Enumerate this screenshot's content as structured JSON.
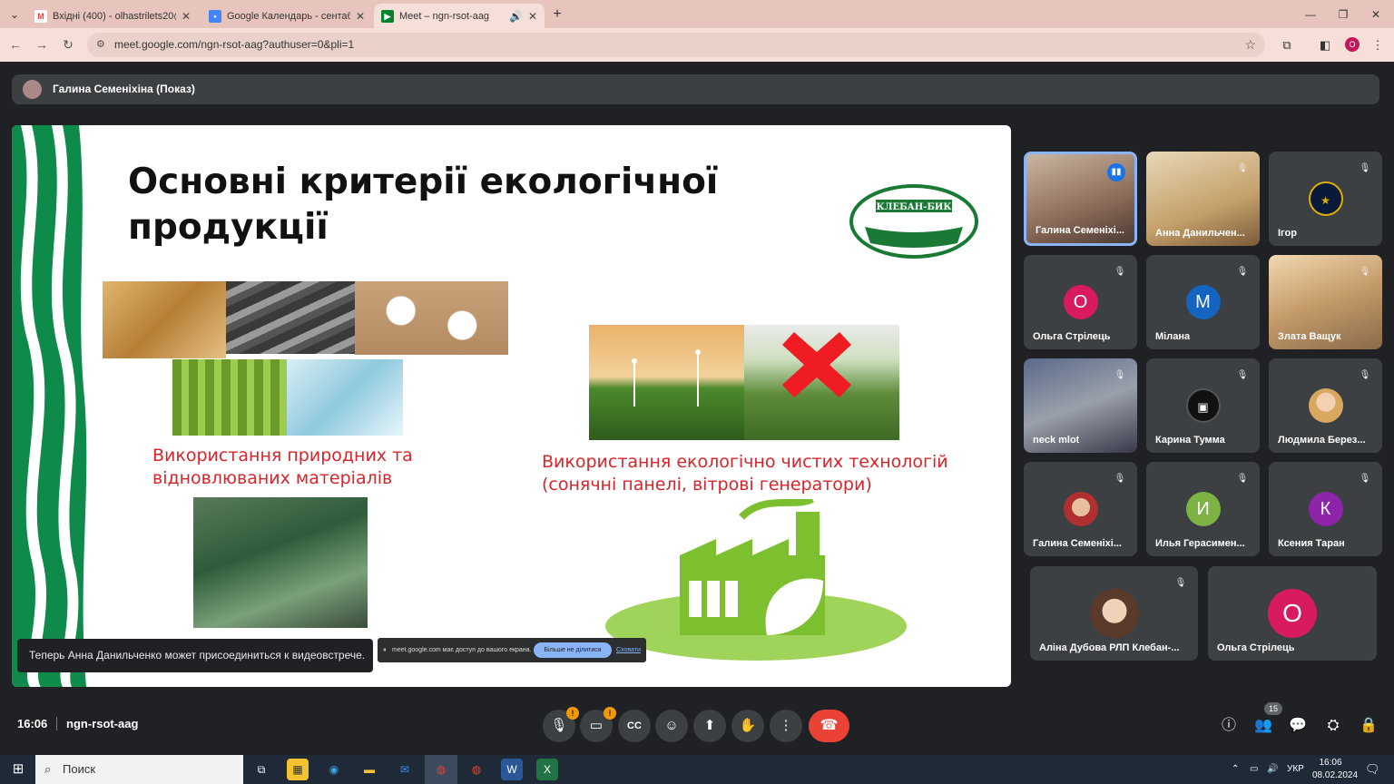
{
  "browser": {
    "tabs": [
      {
        "title": "Вхідні (400) - olhastrilets20@g",
        "favicon": "gmail-icon",
        "active": false
      },
      {
        "title": "Google Календарь - сентабрь",
        "favicon": "calendar-icon",
        "active": false
      },
      {
        "title": "Meet – ngn-rsot-aag",
        "favicon": "meet-icon",
        "active": true
      }
    ],
    "url": "meet.google.com/ngn-rsot-aag?authuser=0&pli=1",
    "profile_letter": "O"
  },
  "meet": {
    "presenter_bar": "Галина Семеніхіна (Показ)",
    "slide": {
      "title": "Основні критерії екологічної продукції",
      "caption_left": "Використання природних та відновлюваних матеріалів",
      "caption_right": "Використання екологічно чистих технологій (сонячні панелі, вітрові генератори)",
      "logo_text": "КЛЕБАН-БИК"
    },
    "toast": "Теперь Анна Данильченко может присоединиться к видеовстрече.",
    "share_bar": {
      "text": "meet.google.com має доступ до вашого екрана.",
      "stop": "Більше не ділитися",
      "hide": "Сховати"
    },
    "participants": [
      {
        "name": "Галина Семеніхі...",
        "type": "video",
        "speaking": true
      },
      {
        "name": "Анна Данильчен...",
        "type": "video",
        "muted": true
      },
      {
        "name": "Ігор",
        "type": "avatar-img",
        "muted": true
      },
      {
        "name": "Ольга Стрілець",
        "type": "letter",
        "letter": "О",
        "color": "#d81b60",
        "muted": true
      },
      {
        "name": "Мілана",
        "type": "letter",
        "letter": "М",
        "color": "#1565c0",
        "muted": true
      },
      {
        "name": "Злата Ващук",
        "type": "video",
        "muted": true
      },
      {
        "name": "neck mlot",
        "type": "video",
        "muted": true
      },
      {
        "name": "Карина Тумма",
        "type": "avatar-img",
        "muted": true
      },
      {
        "name": "Людмила Берез...",
        "type": "avatar-img",
        "muted": true
      },
      {
        "name": "Галина Семеніхі...",
        "type": "avatar-img",
        "muted": true
      },
      {
        "name": "Илья Герасимен...",
        "type": "letter",
        "letter": "И",
        "color": "#7cb342",
        "muted": true
      },
      {
        "name": "Ксения Таран",
        "type": "letter",
        "letter": "К",
        "color": "#8e24aa",
        "muted": true
      },
      {
        "name": "Аліна Дубова РЛП Клебан-...",
        "type": "avatar-img",
        "muted": true
      },
      {
        "name": "Ольга Стрілець",
        "type": "letter",
        "letter": "О",
        "color": "#d81b60",
        "muted": false
      }
    ],
    "time": "16:06",
    "meeting_code": "ngn-rsot-aag",
    "participant_count": "15"
  },
  "taskbar": {
    "search": "Поиск",
    "lang": "УКР",
    "time": "16:06",
    "date": "08.02.2024"
  }
}
